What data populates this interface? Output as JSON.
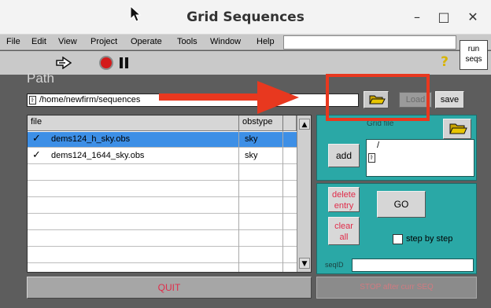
{
  "window": {
    "title": "Grid Sequences",
    "minimize": "–",
    "maximize": "□",
    "close": "✕"
  },
  "menu": [
    "File",
    "Edit",
    "View",
    "Project",
    "Operate",
    "Tools",
    "Window",
    "Help"
  ],
  "toolbar": {
    "help": "?",
    "run_seqs_line1": "run",
    "run_seqs_line2": "seqs"
  },
  "path": {
    "label": "Path",
    "value": "/home/newfirm/sequences",
    "load_label": "Load",
    "save_label": "save"
  },
  "file_table": {
    "headers": [
      "file",
      "obstype"
    ],
    "rows": [
      {
        "check": "✓",
        "file": "dems124_h_sky.obs",
        "obstype": "sky",
        "selected": true
      },
      {
        "check": "✓",
        "file": "dems124_1644_sky.obs",
        "obstype": "sky",
        "selected": false
      }
    ]
  },
  "quit_label": "QUIT",
  "grid_panel": {
    "title": "Grid file",
    "add_label": "add",
    "file_value": "/"
  },
  "controls": {
    "delete_line1": "delete",
    "delete_line2": "entry",
    "clear_line1": "clear",
    "clear_line2": "all",
    "go_label": "GO",
    "step_label": "step by step",
    "step_checked": false,
    "seqid_label": "seqID",
    "seqid_value": ""
  },
  "stop_after_label": "STOP after curr SEQ",
  "colors": {
    "panel_teal": "#2aa8a6",
    "selection_blue": "#3d8fe6",
    "annotation_red": "#e8381f",
    "stop_red": "#d31b1b"
  },
  "icons": [
    "run-arrow-icon",
    "stop-icon",
    "pause-icon",
    "help-icon",
    "folder-open-icon",
    "path-type-icon"
  ]
}
